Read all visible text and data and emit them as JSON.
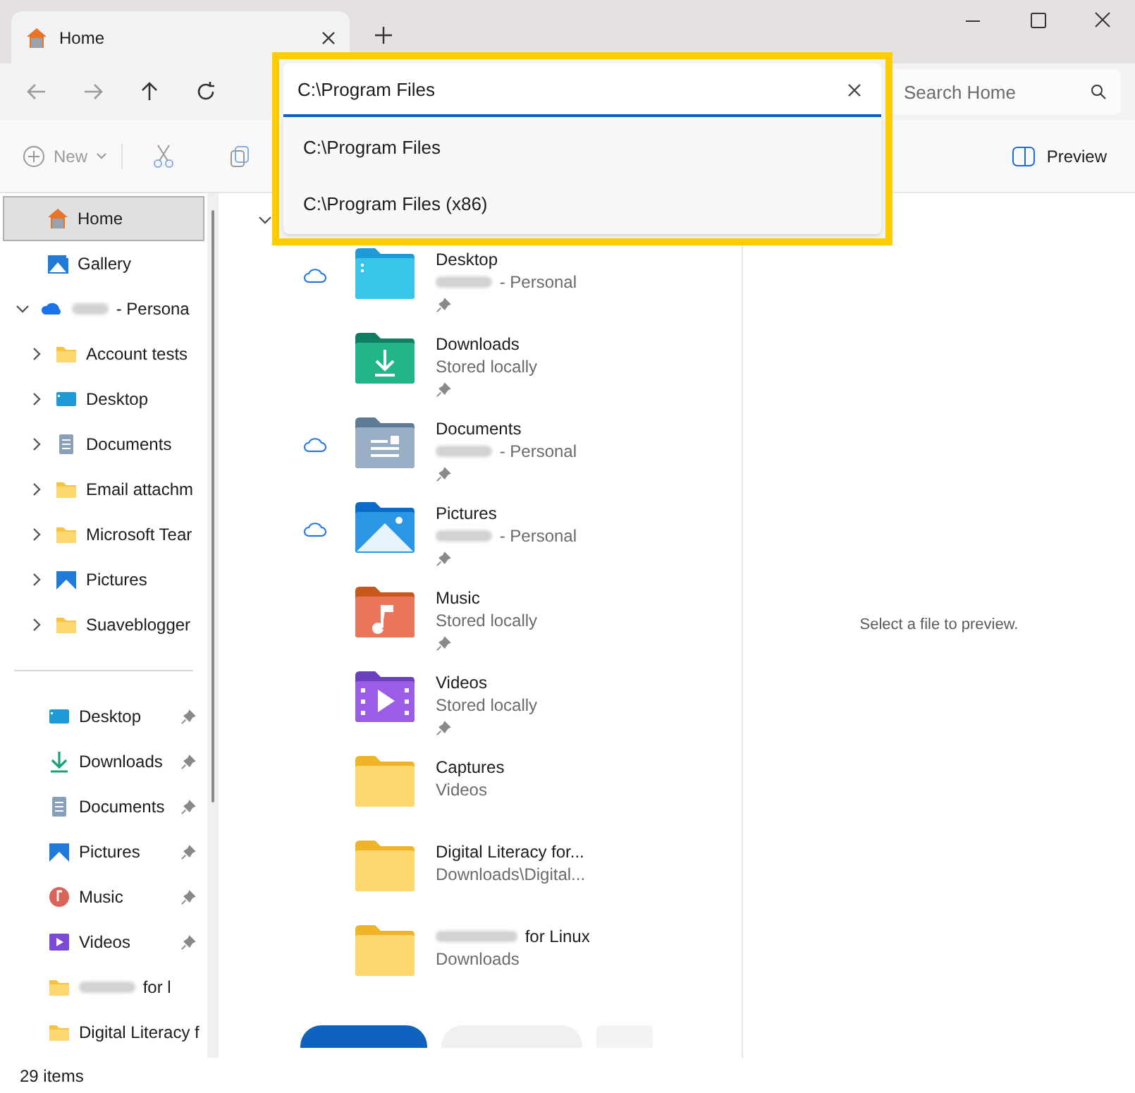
{
  "tab": {
    "title": "Home",
    "selected": true
  },
  "address": {
    "value": "C:\\Program Files",
    "suggestions": [
      "C:\\Program Files",
      "C:\\Program Files (x86)"
    ]
  },
  "search": {
    "placeholder": "Search Home"
  },
  "toolbar": {
    "new": "New",
    "preview": "Preview"
  },
  "sidebar": {
    "items": [
      {
        "label": "Home",
        "kind": "home",
        "selected": true
      },
      {
        "label": "Gallery",
        "kind": "gallery",
        "selected": false
      },
      {
        "label": " - Persona",
        "kind": "onedrive",
        "selected": false,
        "redacted": true,
        "expanded": true,
        "children": [
          {
            "label": "Account tests",
            "kind": "folder",
            "selected": false,
            "expanded": false
          },
          {
            "label": "Desktop",
            "kind": "desktop",
            "selected": false,
            "expanded": false
          },
          {
            "label": "Documents",
            "kind": "documents",
            "selected": false,
            "expanded": false
          },
          {
            "label": "Email attachm",
            "kind": "folder",
            "selected": false,
            "expanded": false
          },
          {
            "label": "Microsoft Tear",
            "kind": "folder",
            "selected": false,
            "expanded": false
          },
          {
            "label": "Pictures",
            "kind": "pictures",
            "selected": false,
            "expanded": false
          },
          {
            "label": "Suaveblogger",
            "kind": "folder",
            "selected": false,
            "expanded": false
          }
        ]
      }
    ],
    "pinned": [
      {
        "label": "Desktop",
        "kind": "desktop",
        "pinned": true
      },
      {
        "label": "Downloads",
        "kind": "downloads",
        "pinned": true
      },
      {
        "label": "Documents",
        "kind": "documents",
        "pinned": true
      },
      {
        "label": "Pictures",
        "kind": "pictures",
        "pinned": true
      },
      {
        "label": "Music",
        "kind": "music",
        "pinned": true
      },
      {
        "label": "Videos",
        "kind": "videos",
        "pinned": true
      },
      {
        "label": " for l",
        "kind": "folder",
        "redacted": true
      },
      {
        "label": "Digital Literacy f",
        "kind": "folder"
      }
    ]
  },
  "quick_access": [
    {
      "name": "Desktop",
      "location": " - Personal",
      "location_redacted": true,
      "kind": "desktop",
      "cloud": true,
      "pinned": true
    },
    {
      "name": "Downloads",
      "location": "Stored locally",
      "kind": "downloads",
      "cloud": false,
      "pinned": true
    },
    {
      "name": "Documents",
      "location": " - Personal",
      "location_redacted": true,
      "kind": "documents",
      "cloud": true,
      "pinned": true
    },
    {
      "name": "Pictures",
      "location": " - Personal",
      "location_redacted": true,
      "kind": "pictures",
      "cloud": true,
      "pinned": true
    },
    {
      "name": "Music",
      "location": "Stored locally",
      "kind": "music",
      "cloud": false,
      "pinned": true
    },
    {
      "name": "Videos",
      "location": "Stored locally",
      "kind": "videos",
      "cloud": false,
      "pinned": true
    },
    {
      "name": "Captures",
      "location": "Videos",
      "kind": "folder",
      "cloud": false,
      "pinned": false
    },
    {
      "name": "Digital Literacy for...",
      "location": "Downloads\\Digital...",
      "kind": "folder",
      "cloud": false,
      "pinned": false
    },
    {
      "name": " for Linux",
      "name_redacted": true,
      "location": "Downloads",
      "kind": "folder",
      "cloud": false,
      "pinned": false
    }
  ],
  "preview_message": "Select a file to preview.",
  "status_bar": {
    "count": "29 items"
  }
}
